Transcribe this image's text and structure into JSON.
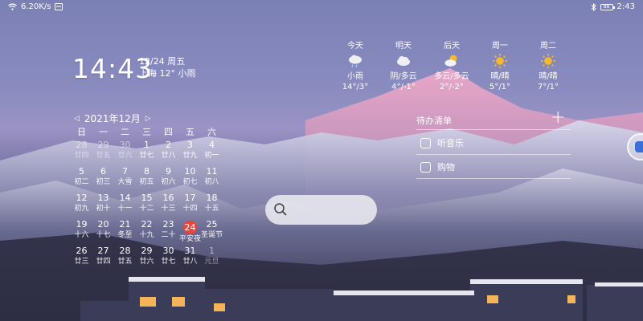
{
  "status_bar": {
    "speed": "6.20K/s",
    "battery": "88",
    "time": "2:43"
  },
  "clock": {
    "time": "14:43",
    "date": "12/24 周五",
    "weather": "上海 12° 小雨"
  },
  "calendar": {
    "month_label": "2021年12月",
    "weekdays": [
      "日",
      "一",
      "二",
      "三",
      "四",
      "五",
      "六"
    ],
    "weeks": [
      [
        {
          "d": "28",
          "l": "廿四",
          "dim": true
        },
        {
          "d": "29",
          "l": "廿五",
          "dim": true
        },
        {
          "d": "30",
          "l": "廿六",
          "dim": true
        },
        {
          "d": "1",
          "l": "廿七"
        },
        {
          "d": "2",
          "l": "廿八"
        },
        {
          "d": "3",
          "l": "廿九"
        },
        {
          "d": "4",
          "l": "初一"
        }
      ],
      [
        {
          "d": "5",
          "l": "初二"
        },
        {
          "d": "6",
          "l": "初三"
        },
        {
          "d": "7",
          "l": "大雪"
        },
        {
          "d": "8",
          "l": "初五"
        },
        {
          "d": "9",
          "l": "初六"
        },
        {
          "d": "10",
          "l": "初七"
        },
        {
          "d": "11",
          "l": "初八"
        }
      ],
      [
        {
          "d": "12",
          "l": "初九"
        },
        {
          "d": "13",
          "l": "初十"
        },
        {
          "d": "14",
          "l": "十一"
        },
        {
          "d": "15",
          "l": "十二"
        },
        {
          "d": "16",
          "l": "十三"
        },
        {
          "d": "17",
          "l": "十四"
        },
        {
          "d": "18",
          "l": "十五"
        }
      ],
      [
        {
          "d": "19",
          "l": "十六"
        },
        {
          "d": "20",
          "l": "十七"
        },
        {
          "d": "21",
          "l": "冬至"
        },
        {
          "d": "22",
          "l": "十九"
        },
        {
          "d": "23",
          "l": "二十"
        },
        {
          "d": "24",
          "l": "平安夜",
          "today": true
        },
        {
          "d": "25",
          "l": "圣诞节"
        }
      ],
      [
        {
          "d": "26",
          "l": "廿三"
        },
        {
          "d": "27",
          "l": "廿四"
        },
        {
          "d": "28",
          "l": "廿五"
        },
        {
          "d": "29",
          "l": "廿六"
        },
        {
          "d": "30",
          "l": "廿七"
        },
        {
          "d": "31",
          "l": "廿八"
        },
        {
          "d": "1",
          "l": "元旦",
          "dim": true
        }
      ]
    ]
  },
  "search": {
    "icon": "search-icon"
  },
  "weather": [
    {
      "day": "今天",
      "icon": "rain",
      "desc": "小雨",
      "temp": "14°/3°"
    },
    {
      "day": "明天",
      "icon": "cloudy",
      "desc": "阴/多云",
      "temp": "4°/-1°"
    },
    {
      "day": "后天",
      "icon": "partly-cloudy",
      "desc": "多云/多云",
      "temp": "2°/-2°"
    },
    {
      "day": "周一",
      "icon": "sunny",
      "desc": "晴/晴",
      "temp": "5°/1°"
    },
    {
      "day": "周二",
      "icon": "sunny",
      "desc": "晴/晴",
      "temp": "7°/1°"
    }
  ],
  "todo": {
    "title": "待办清单",
    "add": "+",
    "items": [
      "听音乐",
      "购物"
    ]
  },
  "colors": {
    "today_highlight": "#e8453c",
    "sun": "#f5b92e"
  }
}
